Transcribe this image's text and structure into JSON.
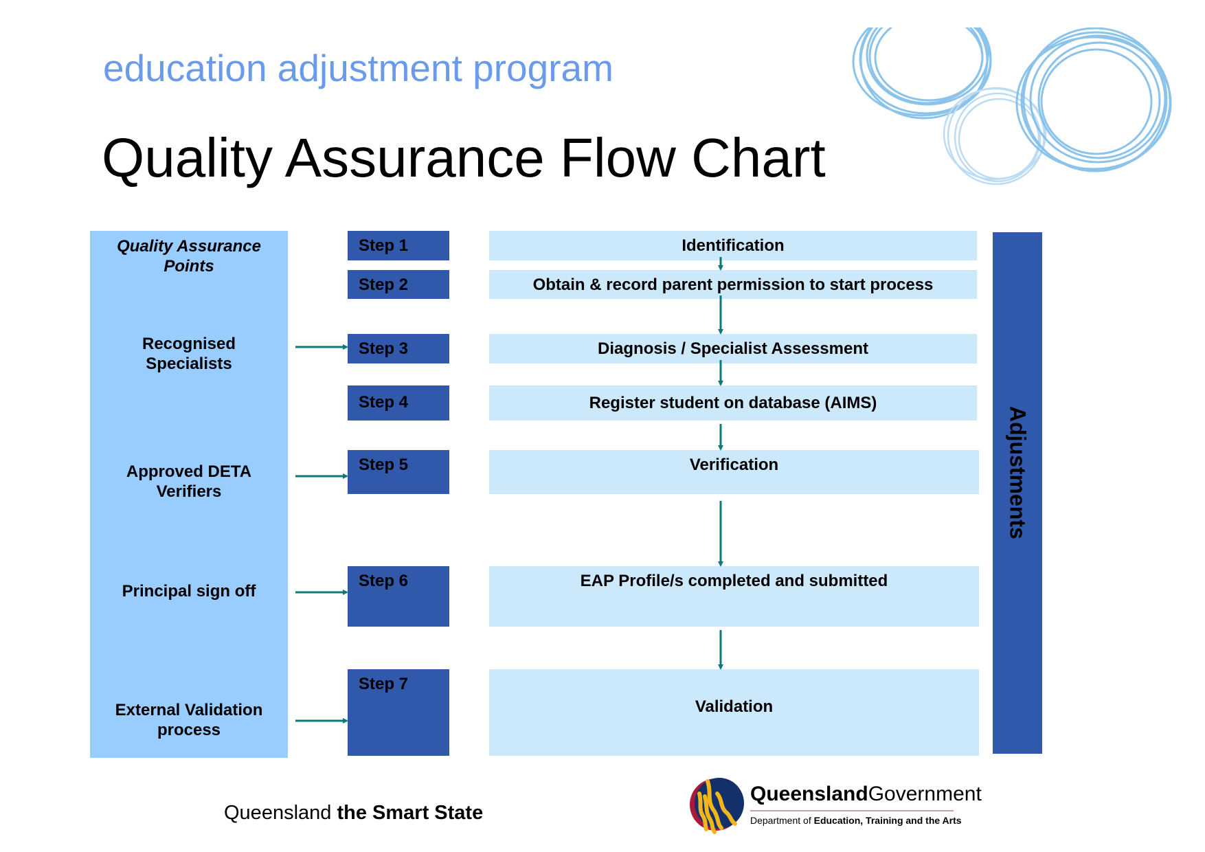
{
  "header": {
    "program": "education adjustment program",
    "title": "Quality Assurance Flow Chart"
  },
  "colors": {
    "program_text": "#6a9bea",
    "qa_panel": "#99ccff",
    "step_box": "#3159ab",
    "process_box": "#cce8fb",
    "arrow": "#0e7a78",
    "scribble": "#7fbde8"
  },
  "qa_panel": {
    "heading": [
      "Quality Assurance",
      "Points"
    ],
    "points": [
      {
        "lines": [
          "Recognised",
          "Specialists"
        ],
        "step": "Step 3"
      },
      {
        "lines": [
          "Approved DETA",
          "Verifiers"
        ],
        "step": "Step 5"
      },
      {
        "lines": [
          "Principal sign off"
        ],
        "step": "Step 6"
      },
      {
        "lines": [
          "External Validation",
          "process"
        ],
        "step": "Step 7"
      }
    ]
  },
  "steps": [
    {
      "label": "Step 1",
      "process": "Identification"
    },
    {
      "label": "Step 2",
      "process": "Obtain & record parent permission to start process"
    },
    {
      "label": "Step 3",
      "process": "Diagnosis / Specialist Assessment"
    },
    {
      "label": "Step 4",
      "process": "Register student on database (AIMS)"
    },
    {
      "label": "Step 5",
      "process": "Verification"
    },
    {
      "label": "Step 6",
      "process": "EAP Profile/s completed and submitted"
    },
    {
      "label": "Step 7",
      "process": "Validation"
    }
  ],
  "side_bar": {
    "label": "Adjustments"
  },
  "footer": {
    "slogan_regular": "Queensland",
    "slogan_bold": "the Smart State",
    "govt_bold": "Queensland",
    "govt_regular": "Government",
    "dept_regular": "Department of",
    "dept_bold": "Education, Training and the Arts"
  }
}
